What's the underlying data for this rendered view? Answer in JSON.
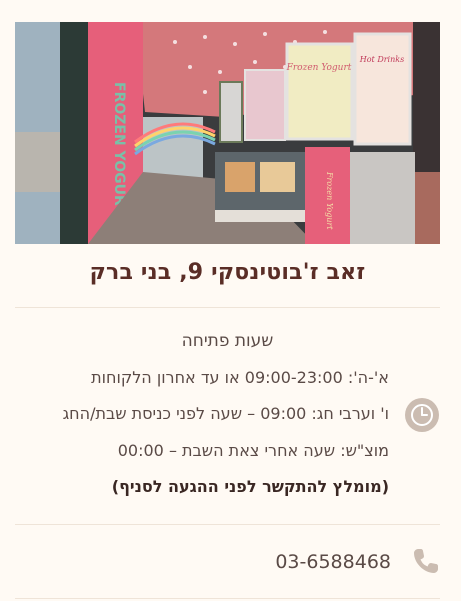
{
  "store": {
    "title": "זאב ז'בוטינסקי 9, בני ברק",
    "photo_description_icon": "storefront-photo"
  },
  "hours": {
    "heading": "שעות פתיחה",
    "lines": [
      "א'-ה': 09:00-23:00 או עד אחרון הלקוחות",
      "ו' וערבי חג: 09:00 – שעה לפני כניסת שבת/החג",
      "מוצ\"ש: שעה אחרי צאת השבת – 00:00"
    ],
    "note": "(מומלץ להתקשר לפני ההגעה לסניף)",
    "icon": "clock-icon"
  },
  "contact": {
    "phone": "03-6588468",
    "icon": "phone-icon"
  },
  "colors": {
    "background": "#fffaf4",
    "title": "#5a2d26",
    "icon_bg": "#cbbcb1",
    "divider": "#efe4d8"
  }
}
